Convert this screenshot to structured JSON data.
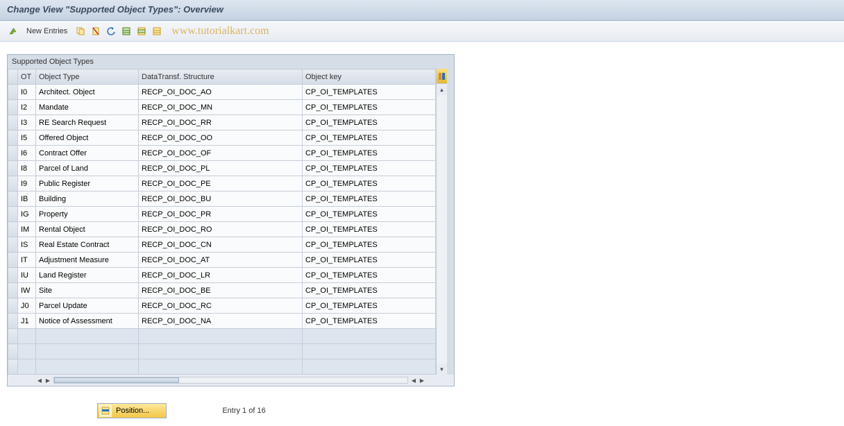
{
  "title": "Change View \"Supported Object Types\": Overview",
  "toolbar": {
    "new_entries": "New Entries"
  },
  "watermark": "www.tutorialkart.com",
  "table": {
    "caption": "Supported Object Types",
    "columns": {
      "ot": "OT",
      "object_type": "Object Type",
      "data_transf": "DataTransf. Structure",
      "object_key": "Object key"
    },
    "rows": [
      {
        "ot": "I0",
        "otype": "Architect. Object",
        "dts": "RECP_OI_DOC_AO",
        "key": "CP_OI_TEMPLATES"
      },
      {
        "ot": "I2",
        "otype": "Mandate",
        "dts": "RECP_OI_DOC_MN",
        "key": "CP_OI_TEMPLATES"
      },
      {
        "ot": "I3",
        "otype": "RE Search Request",
        "dts": "RECP_OI_DOC_RR",
        "key": "CP_OI_TEMPLATES"
      },
      {
        "ot": "I5",
        "otype": "Offered Object",
        "dts": "RECP_OI_DOC_OO",
        "key": "CP_OI_TEMPLATES"
      },
      {
        "ot": "I6",
        "otype": "Contract Offer",
        "dts": "RECP_OI_DOC_OF",
        "key": "CP_OI_TEMPLATES"
      },
      {
        "ot": "I8",
        "otype": "Parcel of Land",
        "dts": "RECP_OI_DOC_PL",
        "key": "CP_OI_TEMPLATES"
      },
      {
        "ot": "I9",
        "otype": "Public Register",
        "dts": "RECP_OI_DOC_PE",
        "key": "CP_OI_TEMPLATES"
      },
      {
        "ot": "IB",
        "otype": "Building",
        "dts": "RECP_OI_DOC_BU",
        "key": "CP_OI_TEMPLATES"
      },
      {
        "ot": "IG",
        "otype": "Property",
        "dts": "RECP_OI_DOC_PR",
        "key": "CP_OI_TEMPLATES"
      },
      {
        "ot": "IM",
        "otype": "Rental Object",
        "dts": "RECP_OI_DOC_RO",
        "key": "CP_OI_TEMPLATES"
      },
      {
        "ot": "IS",
        "otype": "Real Estate Contract",
        "dts": "RECP_OI_DOC_CN",
        "key": "CP_OI_TEMPLATES"
      },
      {
        "ot": "IT",
        "otype": "Adjustment Measure",
        "dts": "RECP_OI_DOC_AT",
        "key": "CP_OI_TEMPLATES"
      },
      {
        "ot": "IU",
        "otype": "Land Register",
        "dts": "RECP_OI_DOC_LR",
        "key": "CP_OI_TEMPLATES"
      },
      {
        "ot": "IW",
        "otype": "Site",
        "dts": "RECP_OI_DOC_BE",
        "key": "CP_OI_TEMPLATES"
      },
      {
        "ot": "J0",
        "otype": "Parcel Update",
        "dts": "RECP_OI_DOC_RC",
        "key": "CP_OI_TEMPLATES"
      },
      {
        "ot": "J1",
        "otype": "Notice of Assessment",
        "dts": "RECP_OI_DOC_NA",
        "key": "CP_OI_TEMPLATES"
      }
    ]
  },
  "footer": {
    "position_label": "Position...",
    "entry_text": "Entry 1 of 16"
  }
}
